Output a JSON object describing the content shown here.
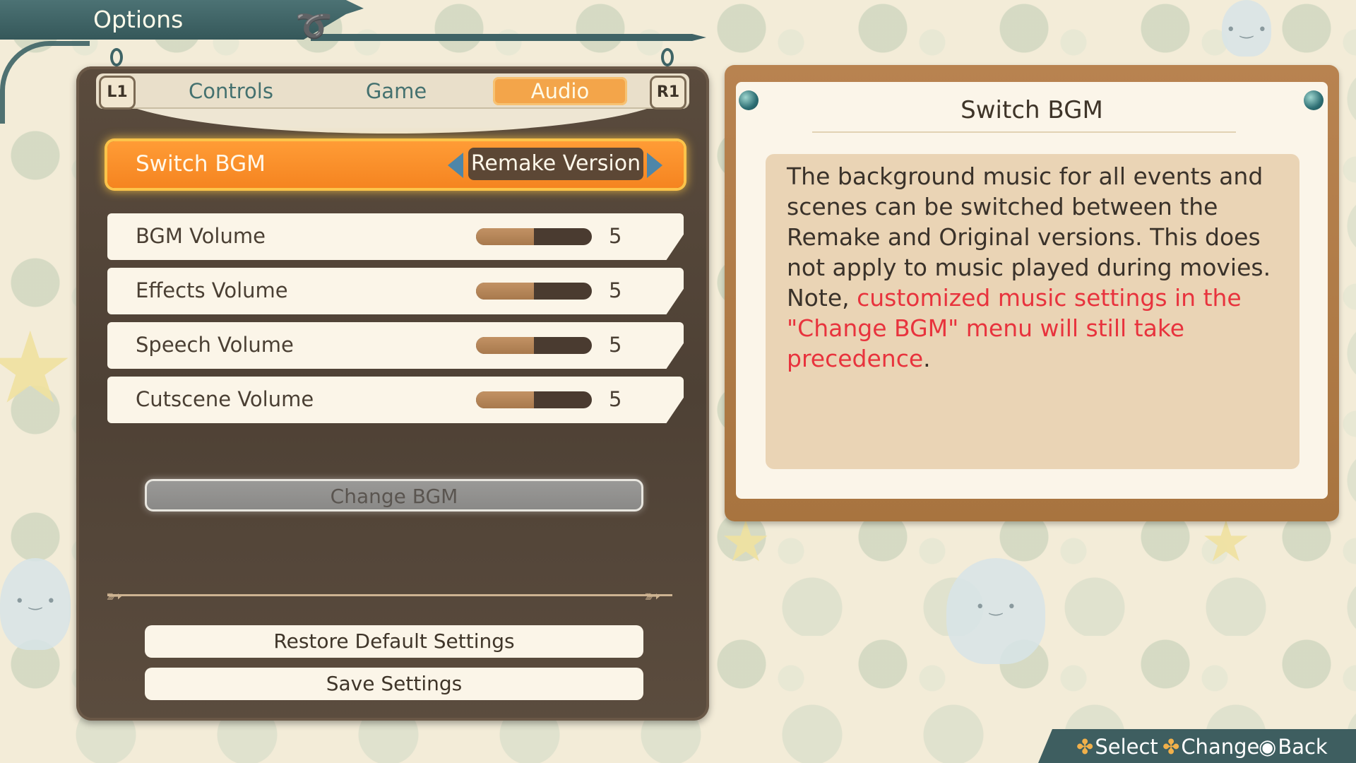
{
  "header": {
    "title": "Options"
  },
  "tabs": {
    "left_button": "L1",
    "right_button": "R1",
    "items": [
      {
        "label": "Controls",
        "active": false
      },
      {
        "label": "Game",
        "active": false
      },
      {
        "label": "Audio",
        "active": true
      }
    ]
  },
  "switch_bgm": {
    "label": "Switch BGM",
    "value": "Remake Version"
  },
  "volumes": [
    {
      "label": "BGM Volume",
      "value": "5",
      "level_fraction": 0.5
    },
    {
      "label": "Effects Volume",
      "value": "5",
      "level_fraction": 0.5
    },
    {
      "label": "Speech Volume",
      "value": "5",
      "level_fraction": 0.5
    },
    {
      "label": "Cutscene Volume",
      "value": "5",
      "level_fraction": 0.5
    }
  ],
  "buttons": {
    "change_bgm": "Change BGM",
    "restore_defaults": "Restore Default Settings",
    "save": "Save Settings"
  },
  "help": {
    "title": "Switch BGM",
    "text_line1": "The background music for all events and scenes can be switched between the Remake and Original versions. This does not apply to music played during movies.",
    "note_prefix": "Note, ",
    "note_highlight": "customized music settings in the \"Change BGM\" menu will still take precedence",
    "note_suffix": ".",
    "highlight_color": "#e8333d"
  },
  "footer": {
    "select": "Select",
    "change": "Change",
    "back": "Back",
    "select_icon": "dpad-icon",
    "change_icon": "dpad-icon",
    "back_icon": "circle-button-icon"
  },
  "colors": {
    "accent_orange": "#f58420",
    "panel_brown": "#4e4135",
    "teal": "#3e5e60"
  }
}
